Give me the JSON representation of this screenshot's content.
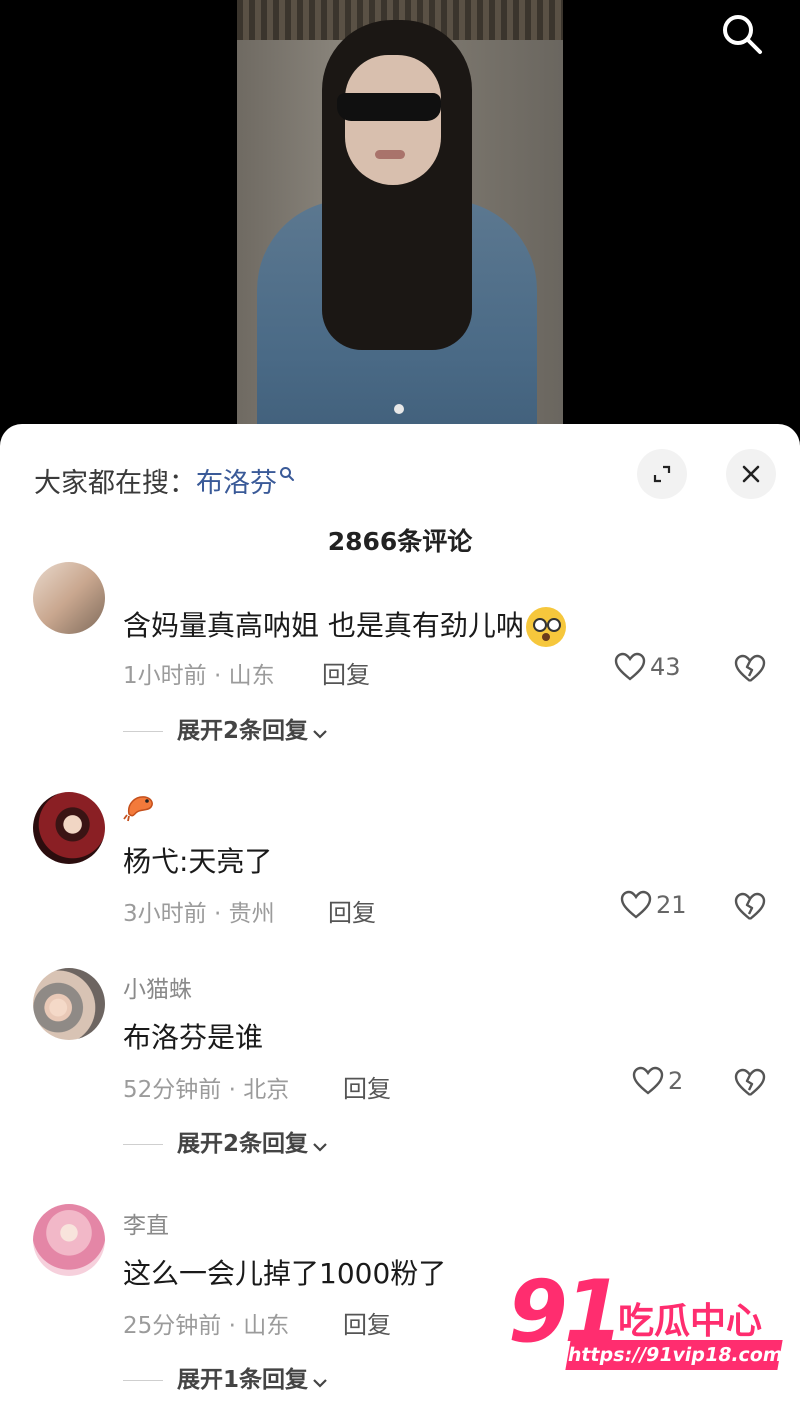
{
  "search_hint": {
    "prefix": "大家都在搜：",
    "term": "布洛芬"
  },
  "comment_count": "2866条评论",
  "comments": [
    {
      "username": "",
      "text": "含妈量真高呐姐 也是真有劲儿呐",
      "time_location": "1小时前 · 山东",
      "reply_label": "回复",
      "likes": "43",
      "expand_label": "展开2条回复"
    },
    {
      "username": "🦐",
      "text": "杨弋:天亮了",
      "time_location": "3小时前 · 贵州",
      "reply_label": "回复",
      "likes": "21"
    },
    {
      "username": "小猫蛛",
      "text": "布洛芬是谁",
      "time_location": "52分钟前 · 北京",
      "reply_label": "回复",
      "likes": "2",
      "expand_label": "展开2条回复"
    },
    {
      "username": "李直",
      "text": "这么一会儿掉了1000粉了",
      "time_location": "25分钟前 · 山东",
      "reply_label": "回复",
      "likes": "",
      "expand_label": "展开1条回复"
    }
  ],
  "watermark": {
    "number": "91",
    "title": "吃瓜中心",
    "url": "https://91vip18.com"
  },
  "colors": {
    "accent_link": "#3a5a98",
    "watermark": "#ff2d6f"
  }
}
